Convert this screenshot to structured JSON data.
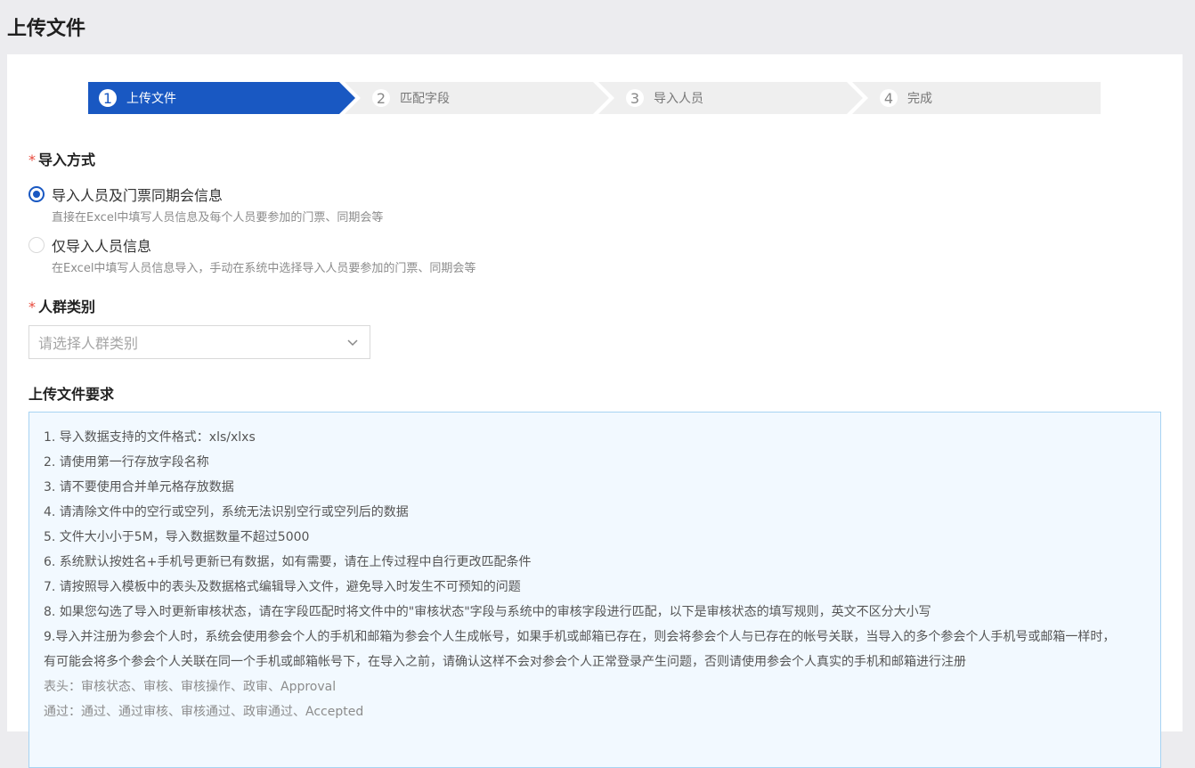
{
  "page_title": "上传文件",
  "steps": [
    {
      "num": "1",
      "label": "上传文件"
    },
    {
      "num": "2",
      "label": "匹配字段"
    },
    {
      "num": "3",
      "label": "导入人员"
    },
    {
      "num": "4",
      "label": "完成"
    }
  ],
  "current_step": 1,
  "import_mode": {
    "required_mark": "*",
    "label": "导入方式",
    "options": [
      {
        "label": "导入人员及门票同期会信息",
        "desc": "直接在Excel中填写人员信息及每个人员要参加的门票、同期会等",
        "checked": true
      },
      {
        "label": "仅导入人员信息",
        "desc": "在Excel中填写人员信息导入，手动在系统中选择导入人员要参加的门票、同期会等",
        "checked": false
      }
    ]
  },
  "crowd_type": {
    "required_mark": "*",
    "label": "人群类别",
    "placeholder": "请选择人群类别"
  },
  "requirements": {
    "title": "上传文件要求",
    "lines": [
      "1. 导入数据支持的文件格式：xls/xlxs",
      "2. 请使用第一行存放字段名称",
      "3. 请不要使用合并单元格存放数据",
      "4. 请清除文件中的空行或空列，系统无法识别空行或空列后的数据",
      "5. 文件大小小于5M，导入数据数量不超过5000",
      "6. 系统默认按姓名+手机号更新已有数据，如有需要，请在上传过程中自行更改匹配条件",
      "7. 请按照导入模板中的表头及数据格式编辑导入文件，避免导入时发生不可预知的问题",
      "8. 如果您勾选了导入时更新审核状态，请在字段匹配时将文件中的\"审核状态\"字段与系统中的审核字段进行匹配，以下是审核状态的填写规则，英文不区分大小写",
      "9.导入并注册为参会个人时，系统会使用参会个人的手机和邮箱为参会个人生成帐号，如果手机或邮箱已存在，则会将参会个人与已存在的帐号关联，当导入的多个参会个人手机号或邮箱一样时，",
      "有可能会将多个参会个人关联在同一个手机或邮箱帐号下，在导入之前，请确认这样不会对参会个人正常登录产生问题，否则请使用参会个人真实的手机和邮箱进行注册"
    ],
    "muted_lines": [
      "表头：审核状态、审核、审核操作、政审、Approval",
      "通过：通过、通过审核、审核通过、政审通过、Accepted"
    ]
  },
  "colors": {
    "primary": "#1958c2",
    "required": "#e8483b",
    "info_bg": "#f2f9ff",
    "info_border": "#a7d3f2"
  }
}
